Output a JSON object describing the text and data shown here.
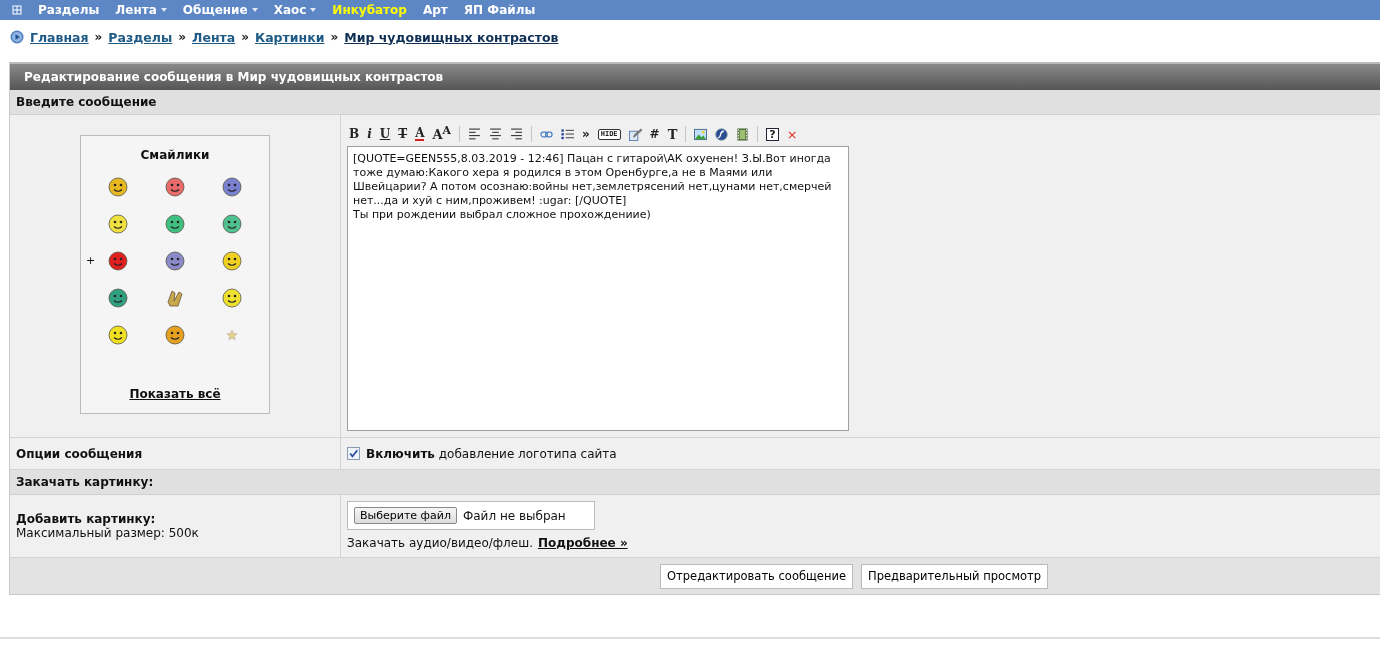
{
  "nav": {
    "items": [
      {
        "label": "Разделы",
        "has_menu": false,
        "highlighted": false
      },
      {
        "label": "Лента",
        "has_menu": true,
        "highlighted": false
      },
      {
        "label": "Общение",
        "has_menu": true,
        "highlighted": false
      },
      {
        "label": "Хаос",
        "has_menu": true,
        "highlighted": false
      },
      {
        "label": "Инкубатор",
        "has_menu": false,
        "highlighted": true
      },
      {
        "label": "Арт",
        "has_menu": false,
        "highlighted": false
      },
      {
        "label": "ЯП Файлы",
        "has_menu": false,
        "highlighted": false
      }
    ]
  },
  "breadcrumb": {
    "separator": "»",
    "items": [
      {
        "label": "Главная",
        "current": false
      },
      {
        "label": "Разделы",
        "current": false
      },
      {
        "label": "Лента",
        "current": false
      },
      {
        "label": "Картинки",
        "current": false
      },
      {
        "label": "Мир чудовищных контрастов",
        "current": true
      }
    ]
  },
  "form": {
    "title": "Редактирование сообщения в Мир чудовищных контрастов",
    "section_message": "Введите сообщение",
    "smilies": {
      "title": "Смайлики",
      "show_all": "Показать всё",
      "items": [
        {
          "kind": "face",
          "color": "#e8b820"
        },
        {
          "kind": "face",
          "color": "#e86a6a"
        },
        {
          "kind": "face",
          "color": "#7a80d0"
        },
        {
          "kind": "face",
          "color": "#f0e040"
        },
        {
          "kind": "face",
          "color": "#40c080"
        },
        {
          "kind": "face",
          "color": "#50c090"
        },
        {
          "kind": "face",
          "color": "#e02020",
          "marker": "+"
        },
        {
          "kind": "face",
          "color": "#8a8ac8"
        },
        {
          "kind": "face",
          "color": "#f0d020"
        },
        {
          "kind": "face",
          "color": "#30a080"
        },
        {
          "kind": "hands",
          "color": "#c8a848"
        },
        {
          "kind": "face",
          "color": "#f0e030"
        },
        {
          "kind": "face",
          "color": "#f0e020"
        },
        {
          "kind": "face",
          "color": "#e8a020"
        },
        {
          "kind": "star",
          "color": "#e8d090"
        }
      ]
    },
    "toolbar": [
      {
        "kind": "bold",
        "label": "B"
      },
      {
        "kind": "italic",
        "label": "i"
      },
      {
        "kind": "underline",
        "label": "U"
      },
      {
        "kind": "strike",
        "label": "T"
      },
      {
        "kind": "color",
        "label": "A"
      },
      {
        "kind": "size",
        "label": "A$^{A}$"
      },
      {
        "kind": "separator"
      },
      {
        "kind": "align-left"
      },
      {
        "kind": "align-center"
      },
      {
        "kind": "align-right"
      },
      {
        "kind": "separator"
      },
      {
        "kind": "link"
      },
      {
        "kind": "list"
      },
      {
        "kind": "glyph",
        "label": "»"
      },
      {
        "kind": "hide",
        "label": "HIDE"
      },
      {
        "kind": "edit"
      },
      {
        "kind": "glyph",
        "label": "#"
      },
      {
        "kind": "serif",
        "label": "T"
      },
      {
        "kind": "separator"
      },
      {
        "kind": "image"
      },
      {
        "kind": "flash"
      },
      {
        "kind": "video"
      },
      {
        "kind": "separator"
      },
      {
        "kind": "help",
        "label": "?"
      },
      {
        "kind": "close",
        "label": "×"
      }
    ],
    "message": "[QUOTE=GEEN555,8.03.2019 - 12:46] Пацан с гитарой\\АК охуенен! З.Ы.Вот иногда тоже думаю:Какого хера я родился в этом Оренбурге,а не в Маями или Швейцарии? А потом осознаю:войны нет,землетрясений нет,цунами нет,смерчей нет...да и хуй с ним,проживем! :ugar: [/QUOTE]\nТы при рождении выбрал сложное прохождениие)",
    "options_label": "Опции сообщения",
    "logo_option": {
      "text": "**Включить** добавление логотипа сайта",
      "checked": true
    },
    "section_upload": "Закачать картинку:",
    "add_image_label": "Добавить картинку:",
    "max_size": "Максимальный размер: 500к",
    "file_button": "Выберите файл",
    "file_status": "Файл не выбран",
    "media_text": "Закачать аудио/видео/флеш.",
    "media_link": "Подробнее »",
    "buttons": [
      "Отредактировать сообщение",
      "Предварительный просмотр"
    ]
  }
}
